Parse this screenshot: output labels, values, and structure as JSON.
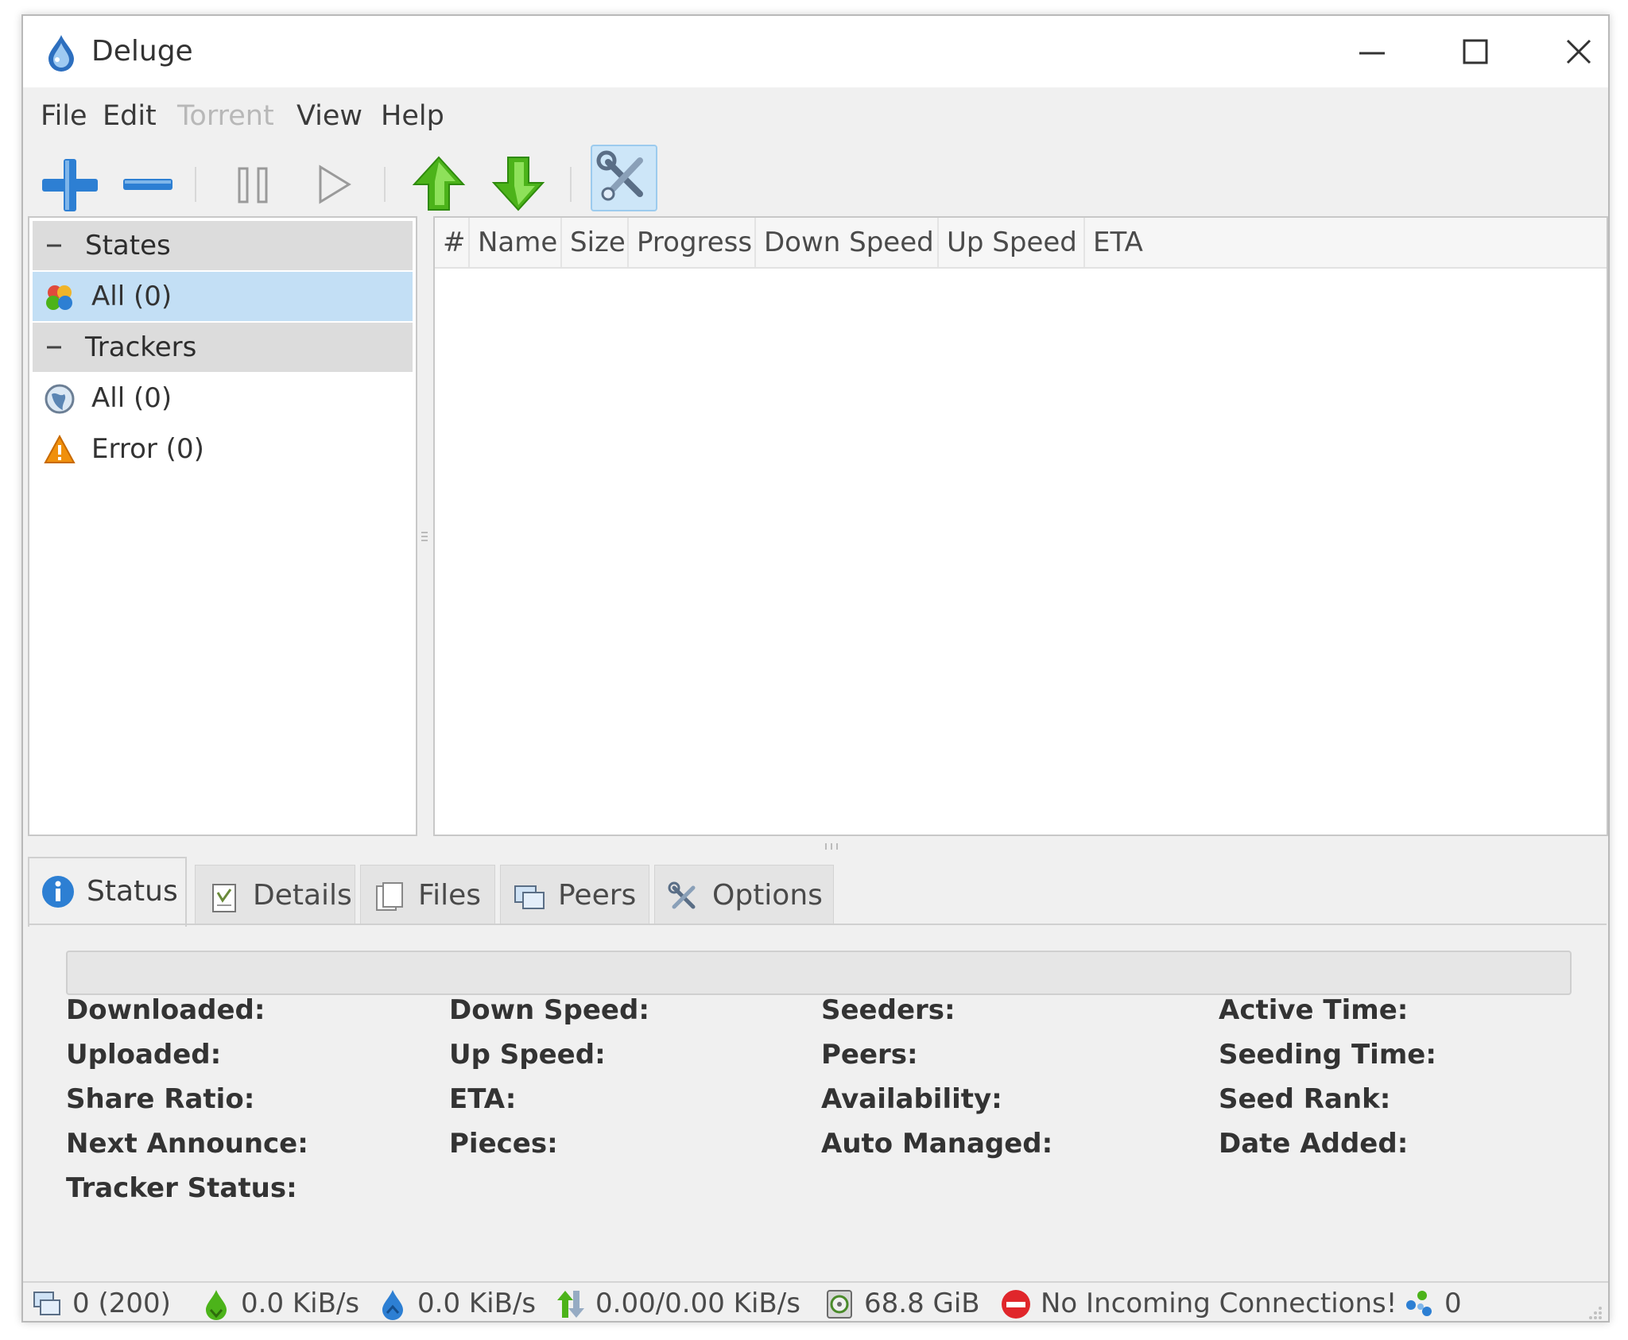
{
  "window": {
    "title": "Deluge"
  },
  "menu": [
    "File",
    "Edit",
    "Torrent",
    "View",
    "Help"
  ],
  "menu_disabled": [
    "Torrent"
  ],
  "toolbar": {
    "buttons": [
      "add-torrent",
      "remove-torrent",
      "pause",
      "resume",
      "queue-up",
      "queue-down",
      "preferences"
    ],
    "icons": [
      "plus-icon",
      "minus-icon",
      "pause-icon",
      "play-icon",
      "arrow-up-icon",
      "arrow-down-icon",
      "wrench-screwdriver-icon"
    ]
  },
  "sidebar": {
    "states_header": "States",
    "states": [
      {
        "label": "All (0)",
        "icon": "all-states-icon",
        "selected": true
      }
    ],
    "trackers_header": "Trackers",
    "trackers": [
      {
        "label": "All (0)",
        "icon": "globe-icon"
      },
      {
        "label": "Error (0)",
        "icon": "warning-icon"
      }
    ]
  },
  "columns": [
    "#",
    "Name",
    "Size",
    "Progress",
    "Down Speed",
    "Up Speed",
    "ETA"
  ],
  "tabs": [
    {
      "label": "Status",
      "icon": "info-icon",
      "active": true
    },
    {
      "label": "Details",
      "icon": "details-icon"
    },
    {
      "label": "Files",
      "icon": "files-icon"
    },
    {
      "label": "Peers",
      "icon": "peers-icon"
    },
    {
      "label": "Options",
      "icon": "options-icon"
    }
  ],
  "status_panel": {
    "progress": 0,
    "col1": [
      "Downloaded:",
      "Uploaded:",
      "Share Ratio:",
      "Next Announce:",
      "Tracker Status:"
    ],
    "col2": [
      "Down Speed:",
      "Up Speed:",
      "ETA:",
      "Pieces:"
    ],
    "col3": [
      "Seeders:",
      "Peers:",
      "Availability:",
      "Auto Managed:"
    ],
    "col4": [
      "Active Time:",
      "Seeding Time:",
      "Seed Rank:",
      "Date Added:"
    ]
  },
  "statusbar": {
    "connections": "0 (200)",
    "download_speed": "0.0 KiB/s",
    "upload_speed": "0.0 KiB/s",
    "protocol_traffic": "0.00/0.00 KiB/s",
    "free_space": "68.8 GiB",
    "incoming": "No Incoming Connections!",
    "dht_nodes": "0"
  },
  "colors": {
    "accent_blue": "#2d7fd3",
    "green": "#4cb31a",
    "selected_row": "#c3dff5",
    "warning_orange": "#f0900c",
    "error_red": "#e0262b"
  }
}
